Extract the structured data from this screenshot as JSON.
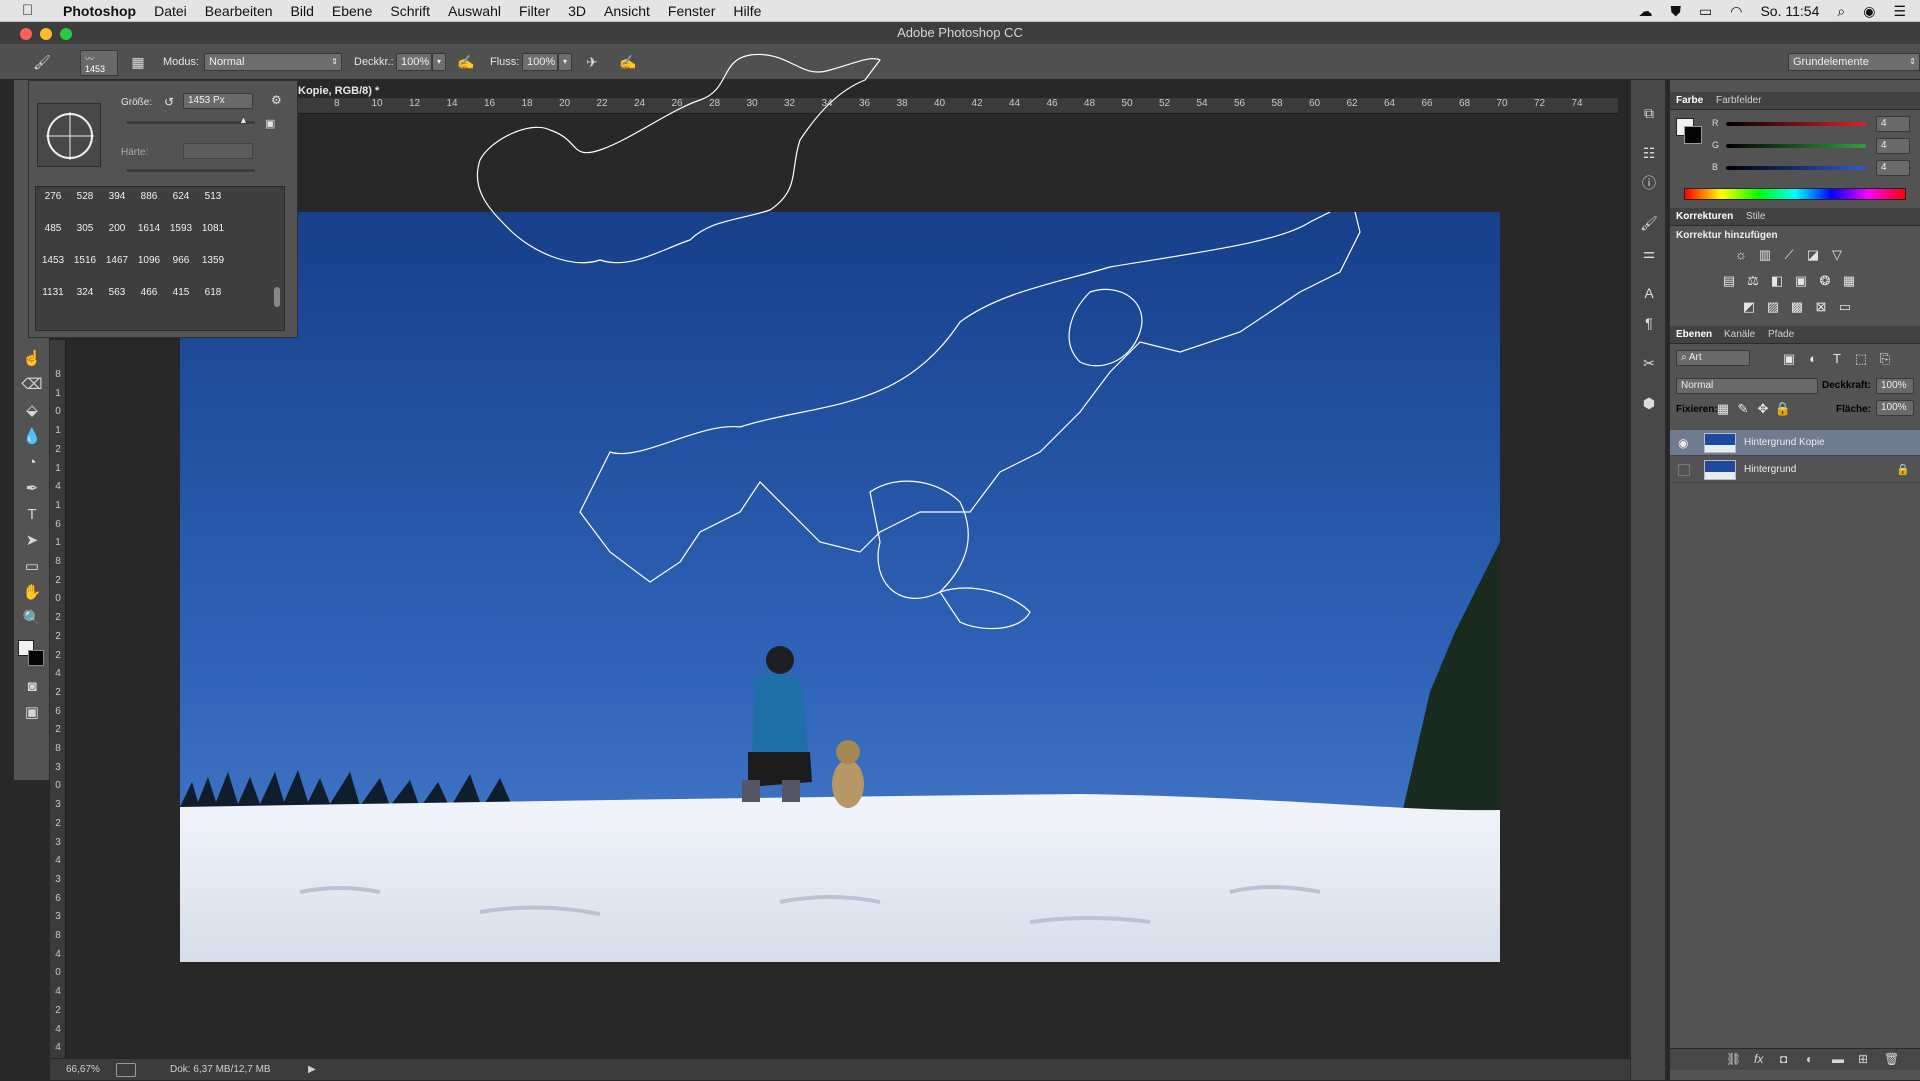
{
  "menubar": {
    "app": "Photoshop",
    "items": [
      "Datei",
      "Bearbeiten",
      "Bild",
      "Ebene",
      "Schrift",
      "Auswahl",
      "Filter",
      "3D",
      "Ansicht",
      "Fenster",
      "Hilfe"
    ],
    "clock": "So. 11:54"
  },
  "window": {
    "title": "Adobe Photoshop CC"
  },
  "options": {
    "brush_size_badge": "1453",
    "modus_label": "Modus:",
    "modus_value": "Normal",
    "deckkraft_label": "Deckkr.:",
    "deckkraft_value": "100%",
    "fluss_label": "Fluss:",
    "fluss_value": "100%",
    "workspace": "Grundelemente"
  },
  "brush_popup": {
    "size_label": "Größe:",
    "size_value": "1453 Px",
    "hardness_label": "Härte:",
    "presets": [
      "276",
      "528",
      "394",
      "886",
      "624",
      "513",
      "485",
      "305",
      "200",
      "1614",
      "1593",
      "1081",
      "1453",
      "1516",
      "1467",
      "1096",
      "966",
      "1359",
      "1131",
      "324",
      "563",
      "466",
      "415",
      "618"
    ]
  },
  "document": {
    "tab_label": "Kopie, RGB/8) *",
    "ruler_h": [
      "8",
      "10",
      "12",
      "14",
      "16",
      "18",
      "20",
      "22",
      "24",
      "26",
      "28",
      "30",
      "32",
      "34",
      "36",
      "38",
      "40",
      "42",
      "44",
      "46",
      "48",
      "50",
      "52",
      "54",
      "56",
      "58",
      "60",
      "62",
      "64",
      "66",
      "68",
      "70",
      "72",
      "74"
    ],
    "ruler_v": [
      "8",
      "1",
      "0",
      "1",
      "2",
      "1",
      "4",
      "1",
      "6",
      "1",
      "8",
      "2",
      "0",
      "2",
      "2",
      "2",
      "4",
      "2",
      "6",
      "2",
      "8",
      "3",
      "0",
      "3",
      "2",
      "3",
      "4",
      "3",
      "6",
      "3",
      "8",
      "4",
      "0",
      "4",
      "2",
      "4",
      "4"
    ]
  },
  "status": {
    "zoom": "66,67%",
    "doc_size": "Dok: 6,37 MB/12,7 MB"
  },
  "panels": {
    "color_tabs": [
      "Farbe",
      "Farbfelder"
    ],
    "rgb": [
      {
        "label": "R",
        "value": "4",
        "color": "#d9252b"
      },
      {
        "label": "G",
        "value": "4",
        "color": "#2fa23b"
      },
      {
        "label": "B",
        "value": "4",
        "color": "#2e5bd6"
      }
    ],
    "adjust_tabs": [
      "Korrekturen",
      "Stile"
    ],
    "adjust_title": "Korrektur hinzufügen",
    "layer_tabs": [
      "Ebenen",
      "Kanäle",
      "Pfade"
    ],
    "layer_filter": "Art",
    "blend_mode": "Normal",
    "opacity_label": "Deckkraft:",
    "opacity_value": "100%",
    "lock_label": "Fixieren:",
    "fill_label": "Fläche:",
    "fill_value": "100%",
    "layers": [
      {
        "name": "Hintergrund Kopie",
        "visible": true,
        "selected": true
      },
      {
        "name": "Hintergrund",
        "visible": false,
        "locked": true
      }
    ]
  }
}
